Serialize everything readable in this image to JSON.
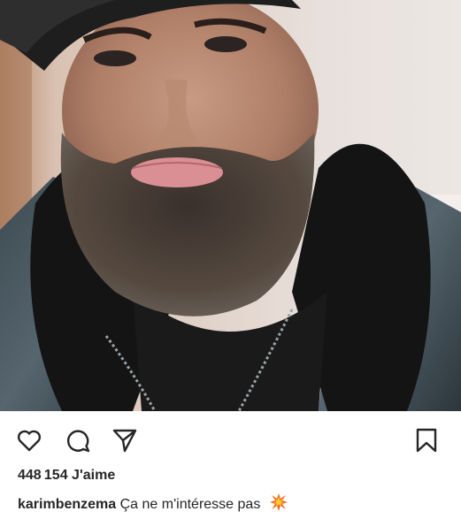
{
  "post": {
    "likes_count": "448154",
    "likes_label": "J'aime",
    "username": "karimbenzema",
    "caption_text": "Ça ne m'intéresse pas",
    "caption_emoji": "collision-icon"
  },
  "actions": {
    "like": "heart-icon",
    "comment": "comment-icon",
    "share": "send-icon",
    "save": "bookmark-icon"
  },
  "colors": {
    "text": "#262626",
    "background": "#ffffff"
  }
}
